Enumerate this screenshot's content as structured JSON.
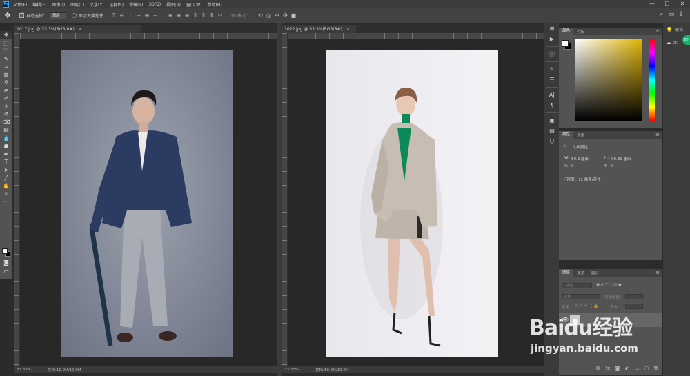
{
  "menu": [
    "文件(F)",
    "编辑(E)",
    "图像(I)",
    "图层(L)",
    "文字(Y)",
    "选择(S)",
    "滤镜(T)",
    "3D(D)",
    "视图(V)",
    "窗口(W)",
    "帮助(H)"
  ],
  "app_logo": "Ps",
  "window_controls": [
    "—",
    "☐",
    "✕"
  ],
  "options": {
    "auto_select": "自动选择：",
    "auto_select_target": "图层",
    "show_transform": "显示变换控件",
    "mode_3d": "3D 模式："
  },
  "documents": [
    {
      "tab": "1017.jpg @ 33.3%(RGB/8#)",
      "close": "✕",
      "zoom": "33.33%",
      "docsize": "文档:10.9M/10.9M"
    },
    {
      "tab": "1022.jpg @ 33.3%(RGB/8#)",
      "close": "✕",
      "zoom": "33.33%",
      "docsize": "文档:10.9M/10.9M"
    }
  ],
  "color_panel": {
    "tabs": [
      "颜色",
      "色板"
    ]
  },
  "properties_panel": {
    "tabs": [
      "属性",
      "调整"
    ],
    "doc_title": "文档属性",
    "w_label": "W:",
    "w_value": "50.8 厘米",
    "h_label": "H:",
    "h_value": "90.31 厘米",
    "x_label": "X:",
    "x_value": "0",
    "y_label": "Y:",
    "y_value": "0",
    "resolution": "分辨率：72 像素/英寸"
  },
  "layers_panel": {
    "tabs": [
      "图层",
      "通道",
      "路径"
    ],
    "filter": "类型",
    "blend": "正常",
    "opacity_label": "不透明度：",
    "lock_label": "锁定：",
    "fill_label": "填充："
  },
  "far_right": [
    {
      "icon": "lightbulb-icon",
      "label": "学习"
    },
    {
      "icon": "library-icon",
      "label": "库"
    }
  ],
  "badge": "60",
  "watermark": {
    "logo": "Baidu经验",
    "url": "jingyan.baidu.com"
  }
}
